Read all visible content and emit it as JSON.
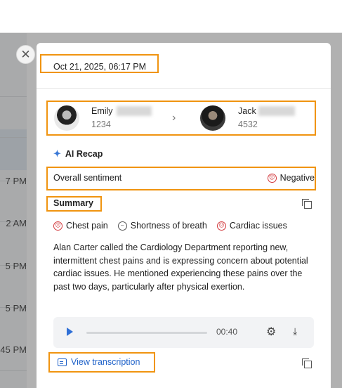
{
  "background": {
    "times": [
      "7 PM",
      "2 AM",
      "5 PM",
      "5 PM",
      "45 PM"
    ]
  },
  "panel": {
    "datetime": "Oct 21, 2025, 06:17 PM",
    "from": {
      "name": "Emily",
      "id": "1234"
    },
    "to": {
      "name": "Jack",
      "id": "4532"
    },
    "ai_recap_label": "AI Recap",
    "sentiment": {
      "label": "Overall sentiment",
      "value": "Negative"
    },
    "summary_label": "Summary",
    "tags": [
      "Chest pain",
      "Shortness of breath",
      "Cardiac issues"
    ],
    "summary_text": "Alan Carter called the Cardiology Department reporting new, intermittent chest pains and is expressing concern about potential cardiac issues. He mentioned experiencing these pains over the past two days, particularly after physical exertion.",
    "player": {
      "time": "00:40"
    },
    "view_transcription_label": "View transcription"
  },
  "colors": {
    "highlight": "#f09410",
    "negative": "#d2383c",
    "accent": "#2f6fd6"
  },
  "icons": [
    "close-icon",
    "chevron-right-icon",
    "sparkle-icon",
    "sad-face-icon",
    "neutral-face-icon",
    "copy-icon",
    "play-icon",
    "gear-icon",
    "download-icon",
    "transcript-icon"
  ]
}
